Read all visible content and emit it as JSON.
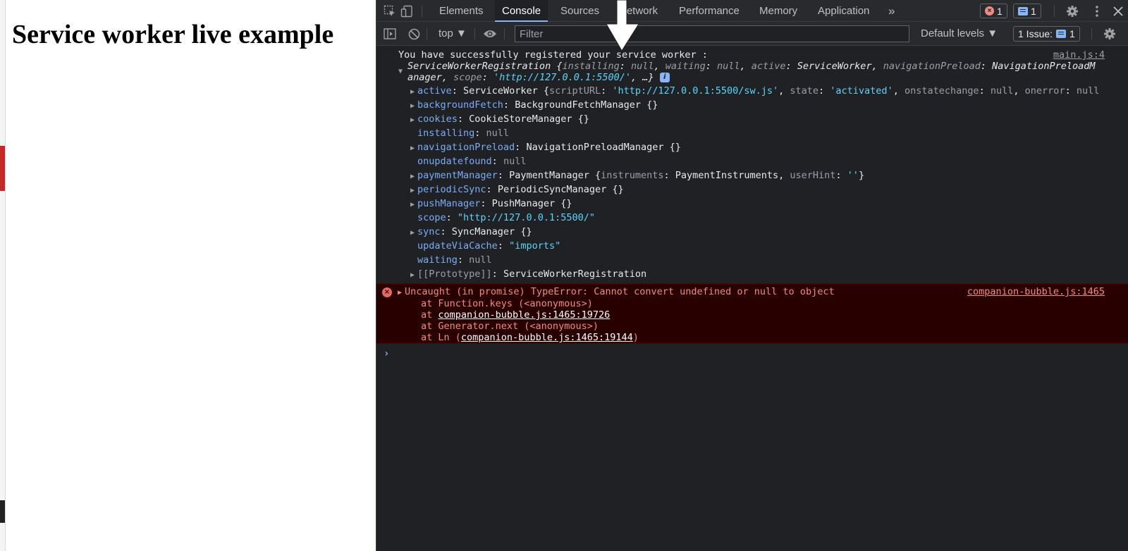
{
  "page": {
    "heading": "Service worker live example"
  },
  "devtools": {
    "tabs": [
      {
        "label": "Elements"
      },
      {
        "label": "Console"
      },
      {
        "label": "Sources"
      },
      {
        "label": "Network"
      },
      {
        "label": "Performance"
      },
      {
        "label": "Memory"
      },
      {
        "label": "Application"
      }
    ],
    "more_tabs": "»",
    "error_count": "1",
    "message_count": "1",
    "context": "top ▼",
    "filter_placeholder": "Filter",
    "levels": "Default levels ▼",
    "issues": {
      "label": "1 Issue:",
      "count": "1"
    }
  },
  "console": {
    "log": {
      "text": "You have successfully registered your service worker :",
      "source": "main.js:4",
      "summary": {
        "type": "ServiceWorkerRegistration",
        "installing_key": "installing",
        "installing_val": "null",
        "waiting_key": "waiting",
        "waiting_val": "null",
        "active_key": "active",
        "active_val": "ServiceWorker",
        "navpreload_key": "navigationPreload",
        "navpreload_val_1": "NavigationPreloadM",
        "navpreload_val_2": "anager",
        "scope_key": "scope",
        "scope_val": "'http://127.0.0.1:5500/'",
        "ellipsis": "…}"
      },
      "properties": {
        "active": {
          "key": "active",
          "type": "ServiceWorker",
          "scripturl_key": "scriptURL",
          "scripturl_val": "'http://127.0.0.1:5500/sw.js'",
          "state_key": "state",
          "state_val": "'activated'",
          "onstatechange_key": "onstatechange",
          "onstatechange_val": "null",
          "onerror_key": "onerror",
          "onerror_val": "null"
        },
        "backgroundFetch": {
          "key": "backgroundFetch",
          "value": "BackgroundFetchManager {}"
        },
        "cookies": {
          "key": "cookies",
          "value": "CookieStoreManager {}"
        },
        "installing": {
          "key": "installing",
          "value": "null"
        },
        "navigationPreload": {
          "key": "navigationPreload",
          "value": "NavigationPreloadManager {}"
        },
        "onupdatefound": {
          "key": "onupdatefound",
          "value": "null"
        },
        "paymentManager": {
          "key": "paymentManager",
          "type": "PaymentManager",
          "instruments_key": "instruments",
          "instruments_val": "PaymentInstruments",
          "userhint_key": "userHint",
          "userhint_val": "''"
        },
        "periodicSync": {
          "key": "periodicSync",
          "value": "PeriodicSyncManager {}"
        },
        "pushManager": {
          "key": "pushManager",
          "value": "PushManager {}"
        },
        "scope": {
          "key": "scope",
          "value": "\"http://127.0.0.1:5500/\""
        },
        "sync": {
          "key": "sync",
          "value": "SyncManager {}"
        },
        "updateViaCache": {
          "key": "updateViaCache",
          "value": "\"imports\""
        },
        "waiting": {
          "key": "waiting",
          "value": "null"
        },
        "prototype": {
          "key": "[[Prototype]]",
          "value": "ServiceWorkerRegistration"
        }
      }
    },
    "error": {
      "message": "Uncaught (in promise) TypeError: Cannot convert undefined or null to object",
      "source": "companion-bubble.js:1465",
      "stack": [
        {
          "prefix": "at Function.keys (<anonymous>)",
          "link": ""
        },
        {
          "prefix": "at ",
          "link": "companion-bubble.js:1465:19726"
        },
        {
          "prefix": "at Generator.next (<anonymous>)",
          "link": ""
        },
        {
          "prefix": "at Ln (",
          "link": "companion-bubble.js:1465:19144",
          "suffix": ")"
        }
      ]
    },
    "prompt": "›"
  },
  "colors": {
    "devtools_bg": "#202124",
    "toolbar_bg": "#292a2d",
    "key": "#7cacf8",
    "string": "#5cd5fb",
    "error_bg": "#290000",
    "error_text": "#f28b82"
  },
  "icons": [
    "inspect-element-icon",
    "device-toolbar-icon",
    "settings-icon",
    "kebab-menu-icon",
    "close-icon",
    "sidebar-toggle-icon",
    "clear-console-icon",
    "eye-icon",
    "annotation-arrow-icon"
  ]
}
